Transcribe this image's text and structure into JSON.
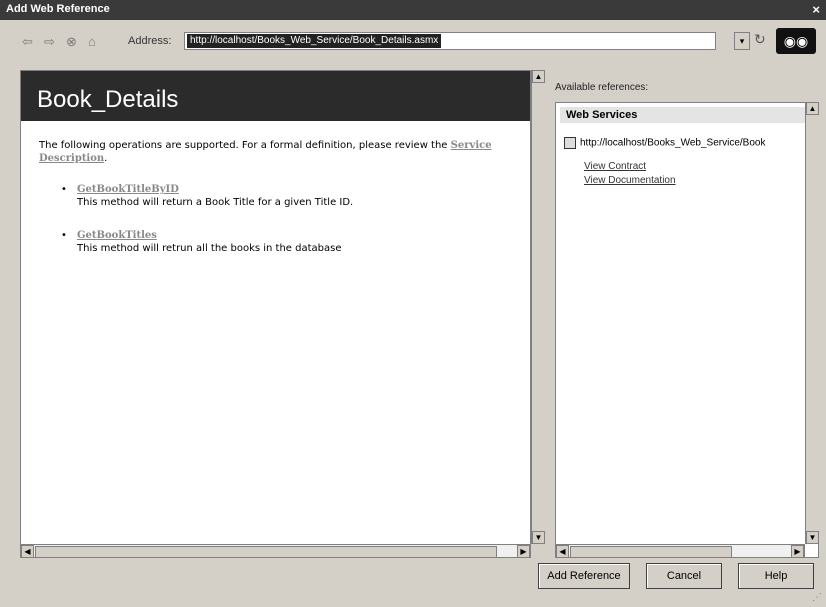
{
  "window": {
    "title": "Add Web Reference",
    "close_glyph": "×"
  },
  "toolbar": {
    "back_icon": "⇦",
    "forward_icon": "⇨",
    "stop_icon": "⊗",
    "home_icon": "⌂",
    "address_label": "Address:",
    "address_value": "http://localhost/Books_Web_Service/Book_Details.asmx",
    "dropdown_glyph": "▾",
    "refresh_icon": "↻",
    "go_glyph": "◉◉"
  },
  "browser": {
    "heading": "Book_Details",
    "intro_text": "The following operations are supported. For a formal definition, please review the",
    "service_description_link": "Service Description",
    "intro_suffix": ".",
    "operations": [
      {
        "name": "GetBookTitleByID",
        "description": "This method will return a Book Title for a given Title ID."
      },
      {
        "name": "GetBookTitles",
        "description": "This method will retrun all the books in the database"
      }
    ],
    "bullet": "•"
  },
  "references": {
    "label": "Available references:",
    "section_title": "Web Services",
    "service_url": "http://localhost/Books_Web_Service/Book",
    "view_contract": "View Contract",
    "view_documentation": "View Documentation"
  },
  "buttons": {
    "add_reference": "Add Reference",
    "cancel": "Cancel",
    "help": "Help"
  },
  "scroll_glyphs": {
    "up": "▲",
    "down": "▼",
    "left": "◀",
    "right": "▶"
  }
}
